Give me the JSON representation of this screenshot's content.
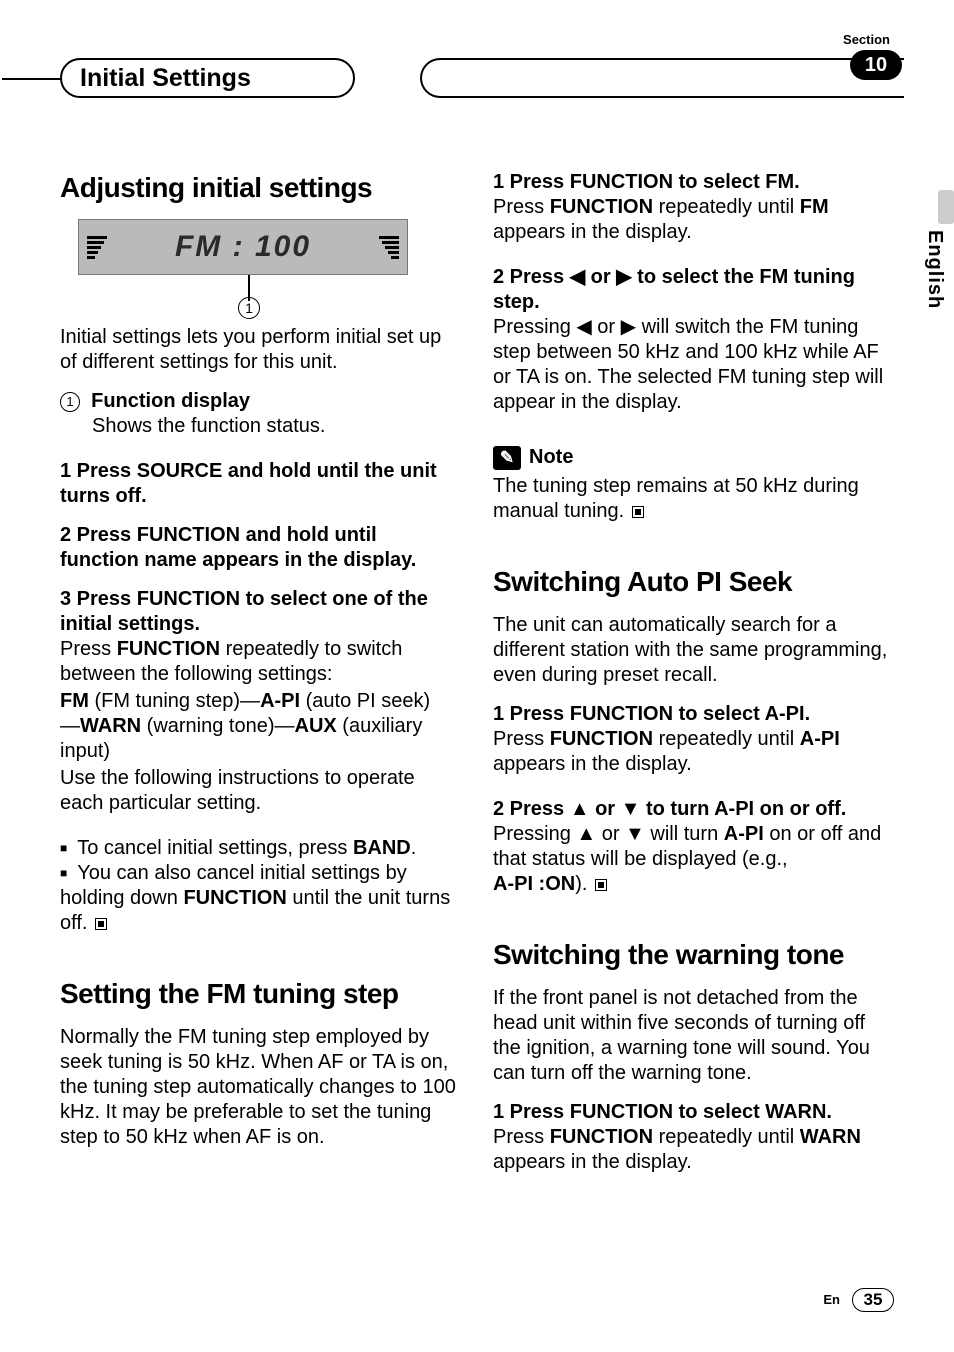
{
  "header": {
    "section_label": "Section",
    "tab_title": "Initial Settings",
    "section_number": "10"
  },
  "language_tab": "English",
  "left": {
    "h1_adjust": "Adjusting initial settings",
    "lcd": {
      "text": "FM   : 100",
      "callout_num": "1"
    },
    "intro": "Initial settings lets you perform initial set up of different settings for this unit.",
    "func_label_num": "1",
    "func_label": "Function display",
    "func_desc": "Shows the function status.",
    "s1": "1   Press SOURCE and hold until the unit turns off.",
    "s2": "2   Press FUNCTION and hold until function name appears in the display.",
    "s3": "3   Press FUNCTION to select one of the initial settings.",
    "s3b_pre": "Press ",
    "s3b_func": "FUNCTION",
    "s3b_post": " repeatedly to switch between the following settings:",
    "opts_line1_fm": "FM",
    "opts_line1_fm_desc": " (FM tuning step)—",
    "opts_line1_api": "A-PI",
    "opts_line1_api_desc": " (auto PI seek)",
    "opts_line2_dash": "—",
    "opts_line2_warn": "WARN",
    "opts_line2_warn_desc": " (warning tone)—",
    "opts_line2_aux": "AUX",
    "opts_line2_aux_desc": " (auxiliary input)",
    "opts_follow": "Use the following instructions to operate each particular setting.",
    "bullet1_pre": "To cancel initial settings, press ",
    "bullet1_band": "BAND",
    "bullet1_post": ".",
    "bullet2_pre": "You can also cancel initial settings by holding down ",
    "bullet2_func": "FUNCTION",
    "bullet2_post": " until the unit turns off.",
    "h1_fm": "Setting the FM tuning step",
    "fm_intro": "Normally the FM tuning step employed by seek tuning is 50 kHz. When AF or TA is on, the tuning step automatically changes to 100 kHz. It may be preferable to set the tuning step to 50 kHz when AF is on."
  },
  "right": {
    "fm_s1": "1   Press FUNCTION to select FM.",
    "fm_s1b_pre": "Press ",
    "fm_s1b_func": "FUNCTION",
    "fm_s1b_mid": " repeatedly until ",
    "fm_s1b_fm": "FM",
    "fm_s1b_post": " appears in the display.",
    "fm_s2": "2   Press ◀ or ▶ to select the FM tuning step.",
    "fm_s2b": "Pressing ◀ or ▶ will switch the FM tuning step between 50 kHz and 100 kHz while AF or TA is on. The selected FM tuning step will appear in the display.",
    "note_label": "Note",
    "note_body": "The tuning step remains at 50 kHz during manual tuning.",
    "h1_api": "Switching Auto PI Seek",
    "api_intro": "The unit can automatically search for a different station with the same programming, even during preset recall.",
    "api_s1": "1   Press FUNCTION to select A-PI.",
    "api_s1b_pre": "Press ",
    "api_s1b_func": "FUNCTION",
    "api_s1b_mid": " repeatedly until ",
    "api_s1b_api": "A-PI",
    "api_s1b_post": " appears in the display.",
    "api_s2": "2   Press ▲ or ▼ to turn A-PI on or off.",
    "api_s2b_pre": "Pressing ▲ or ▼ will turn ",
    "api_s2b_api": "A-PI",
    "api_s2b_mid": " on or off and that status will be displayed (e.g., ",
    "api_s2b_ex": "A-PI :ON",
    "api_s2b_post": ").",
    "h1_warn": "Switching the warning tone",
    "warn_intro": "If the front panel is not detached from the head unit within five seconds of turning off the ignition, a warning tone will sound. You can turn off the warning tone.",
    "warn_s1": "1   Press FUNCTION to select WARN.",
    "warn_s1b_pre": "Press ",
    "warn_s1b_func": "FUNCTION",
    "warn_s1b_mid": " repeatedly until ",
    "warn_s1b_warn": "WARN",
    "warn_s1b_post": " appears in the display."
  },
  "footer": {
    "lang_code": "En",
    "page": "35"
  }
}
